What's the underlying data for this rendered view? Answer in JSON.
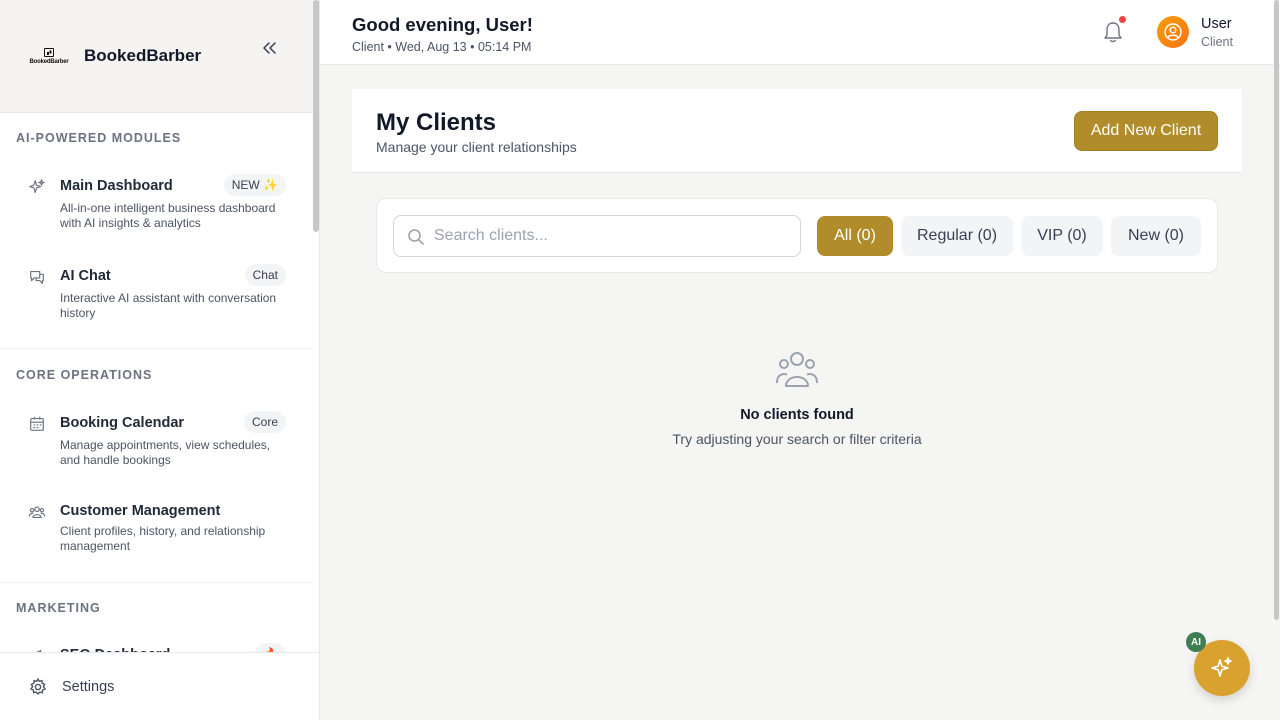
{
  "sidebar": {
    "brand": "BookedBarber",
    "logo_text": "BookedBarber",
    "sections": [
      {
        "title": "AI-POWERED MODULES"
      },
      {
        "title": "CORE OPERATIONS"
      },
      {
        "title": "MARKETING"
      }
    ],
    "items": [
      {
        "title": "Main Dashboard",
        "desc": "All-in-one intelligent business dashboard with AI insights & analytics",
        "badge": "NEW ✨",
        "icon": "sparkles-icon"
      },
      {
        "title": "AI Chat",
        "desc": "Interactive AI assistant with conversation history",
        "badge": "Chat",
        "icon": "chat-icon"
      },
      {
        "title": "Booking Calendar",
        "desc": "Manage appointments, view schedules, and handle bookings",
        "badge": "Core",
        "icon": "calendar-icon"
      },
      {
        "title": "Customer Management",
        "desc": "Client profiles, history, and relationship management",
        "badge": "",
        "icon": "users-icon"
      },
      {
        "title": "SEO Dashboard",
        "desc": "",
        "badge": "🔥",
        "icon": "megaphone-icon"
      }
    ],
    "footer": {
      "settings_label": "Settings"
    }
  },
  "header": {
    "greeting": "Good evening, User!",
    "subline": "Client • Wed, Aug 13 • 05:14 PM",
    "user_name": "User",
    "user_role": "Client",
    "notification_dot_color": "#ef4444"
  },
  "main": {
    "title": "My Clients",
    "subtitle": "Manage your client relationships",
    "add_button": "Add New Client",
    "search_placeholder": "Search clients...",
    "filters": [
      {
        "label": "All (0)",
        "active": true
      },
      {
        "label": "Regular (0)",
        "active": false
      },
      {
        "label": "VIP (0)",
        "active": false
      },
      {
        "label": "New (0)",
        "active": false
      }
    ],
    "empty": {
      "title": "No clients found",
      "subtitle": "Try adjusting your search or filter criteria"
    }
  },
  "fab": {
    "badge": "AI"
  },
  "colors": {
    "accent": "#b08d2a",
    "fab": "#d9a22f",
    "fab_badge": "#3f7d53"
  }
}
